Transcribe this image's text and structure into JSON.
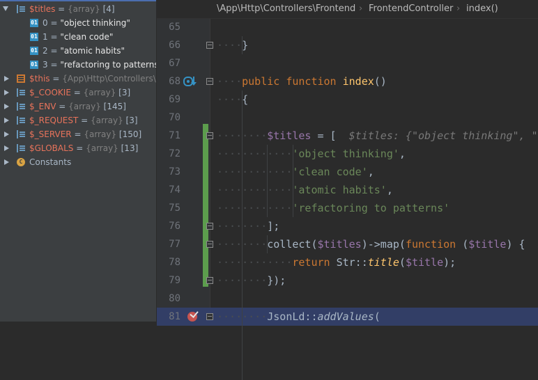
{
  "variables": [
    {
      "arrow": "down",
      "icon": "array",
      "name": "$titles",
      "eq": " = ",
      "type": "{array}",
      "extra": " [4]"
    },
    {
      "icon": "index",
      "name": "0",
      "eq": " = ",
      "value": "\"object thinking\""
    },
    {
      "icon": "index",
      "name": "1",
      "eq": " = ",
      "value": "\"clean code\""
    },
    {
      "icon": "index",
      "name": "2",
      "eq": " = ",
      "value": "\"atomic habits\""
    },
    {
      "icon": "index",
      "name": "3",
      "eq": " = ",
      "value": "\"refactoring to patterns\""
    },
    {
      "arrow": "right",
      "icon": "object",
      "name": "$this",
      "eq": " = ",
      "type": "{App\\Http\\Controllers\\F"
    },
    {
      "arrow": "right",
      "icon": "array",
      "name": "$_COOKIE",
      "eq": " = ",
      "type": "{array}",
      "extra": " [3]"
    },
    {
      "arrow": "right",
      "icon": "array",
      "name": "$_ENV",
      "eq": " = ",
      "type": "{array}",
      "extra": " [145]"
    },
    {
      "arrow": "right",
      "icon": "array",
      "name": "$_REQUEST",
      "eq": " = ",
      "type": "{array}",
      "extra": " [3]"
    },
    {
      "arrow": "right",
      "icon": "array",
      "name": "$_SERVER",
      "eq": " = ",
      "type": "{array}",
      "extra": " [150]"
    },
    {
      "arrow": "right",
      "icon": "array",
      "name": "$GLOBALS",
      "eq": " = ",
      "type": "{array}",
      "extra": " [13]"
    },
    {
      "arrow": "right",
      "icon": "constants",
      "name": "Constants",
      "label": true
    }
  ],
  "breadcrumb": [
    "\\App\\Http\\Controllers\\Frontend",
    "FrontendController",
    "index()"
  ],
  "breadcrumb_sep": "›",
  "lines": [
    {
      "num": "65",
      "tokens": []
    },
    {
      "num": "66",
      "tokens": [
        {
          "t": "····",
          "c": "ws"
        },
        {
          "t": "}"
        }
      ]
    },
    {
      "num": "67",
      "tokens": []
    },
    {
      "num": "68",
      "tokens": [
        {
          "t": "····",
          "c": "ws"
        },
        {
          "t": "public",
          "c": "kw"
        },
        {
          "t": " "
        },
        {
          "t": "function",
          "c": "kw"
        },
        {
          "t": " "
        },
        {
          "t": "index",
          "c": "fn"
        },
        {
          "t": "()"
        }
      ]
    },
    {
      "num": "69",
      "tokens": [
        {
          "t": "····",
          "c": "ws"
        },
        {
          "t": "{"
        }
      ]
    },
    {
      "num": "70",
      "tokens": []
    },
    {
      "num": "71",
      "tokens": [
        {
          "t": "········",
          "c": "ws"
        },
        {
          "t": "$titles",
          "c": "var"
        },
        {
          "t": " = [  "
        },
        {
          "t": "$titles: {\"object thinking\", \"c",
          "c": "hint"
        }
      ]
    },
    {
      "num": "72",
      "tokens": [
        {
          "t": "············",
          "c": "ws"
        },
        {
          "t": "'object thinking'",
          "c": "str"
        },
        {
          "t": ","
        }
      ]
    },
    {
      "num": "73",
      "tokens": [
        {
          "t": "············",
          "c": "ws"
        },
        {
          "t": "'clean code'",
          "c": "str"
        },
        {
          "t": ","
        }
      ]
    },
    {
      "num": "74",
      "tokens": [
        {
          "t": "············",
          "c": "ws"
        },
        {
          "t": "'atomic habits'",
          "c": "str"
        },
        {
          "t": ","
        }
      ]
    },
    {
      "num": "75",
      "tokens": [
        {
          "t": "············",
          "c": "ws"
        },
        {
          "t": "'refactoring to patterns'",
          "c": "str"
        }
      ]
    },
    {
      "num": "76",
      "tokens": [
        {
          "t": "········",
          "c": "ws"
        },
        {
          "t": "];"
        }
      ]
    },
    {
      "num": "77",
      "tokens": [
        {
          "t": "········",
          "c": "ws"
        },
        {
          "t": "collect("
        },
        {
          "t": "$titles",
          "c": "var"
        },
        {
          "t": ")->map("
        },
        {
          "t": "function",
          "c": "kw"
        },
        {
          "t": " ("
        },
        {
          "t": "$title",
          "c": "var"
        },
        {
          "t": ") {  "
        },
        {
          "t": "$",
          "c": "hint"
        }
      ]
    },
    {
      "num": "78",
      "tokens": [
        {
          "t": "············",
          "c": "ws"
        },
        {
          "t": "return",
          "c": "kw"
        },
        {
          "t": " Str::"
        },
        {
          "t": "title",
          "c": "fn it"
        },
        {
          "t": "("
        },
        {
          "t": "$title",
          "c": "var"
        },
        {
          "t": ");"
        }
      ]
    },
    {
      "num": "79",
      "tokens": [
        {
          "t": "········",
          "c": "ws"
        },
        {
          "t": "});"
        }
      ]
    },
    {
      "num": "80",
      "tokens": []
    },
    {
      "num": "81",
      "tokens": [
        {
          "t": "········",
          "c": "ws"
        },
        {
          "t": "JsonLd::"
        },
        {
          "t": "addValues",
          "c": "it"
        },
        {
          "t": "("
        }
      ]
    }
  ]
}
